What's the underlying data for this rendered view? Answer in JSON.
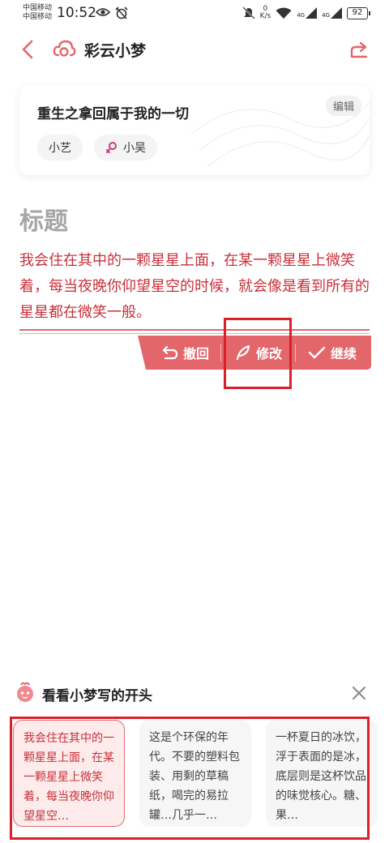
{
  "status": {
    "carrier_1": "中国移动",
    "carrier_2": "中国移动",
    "time": "10:52",
    "speed_value": "0",
    "speed_unit": "K/s",
    "net_1": "4G",
    "net_2": "4G",
    "battery": "92"
  },
  "header": {
    "title": "彩云小梦"
  },
  "story": {
    "title": "重生之拿回属于我的一切",
    "edit_label": "编辑",
    "characters": [
      "小艺",
      "小吴"
    ]
  },
  "content": {
    "section_title": "标题",
    "text": "我会住在其中的一颗星星上面，在某一颗星星上微笑着，每当夜晚你仰望星空的时候，就会像是看到所有的星星都在微笑一般。"
  },
  "actions": {
    "undo": "撤回",
    "modify": "修改",
    "continue": "继续"
  },
  "panel": {
    "title": "看看小梦写的开头",
    "suggestions": [
      "我会住在其中的一颗星星上面，在某一颗星星上微笑着，每当夜晚你仰望星空…",
      "这是个环保的年代。不要的塑料包装、用剩的草稿纸，喝完的易拉罐…几乎一…",
      "一杯夏日的冰饮，浮于表面的是冰，底层则是这杯饮品的味觉核心。糖、果…"
    ]
  },
  "colors": {
    "accent": "#e3666b",
    "text_red": "#c8303a",
    "highlight": "#d9202b"
  },
  "icons": [
    "back-icon",
    "cloud-logo-icon",
    "share-icon",
    "female-icon",
    "undo-icon",
    "feather-icon",
    "check-icon",
    "mascot-icon",
    "close-icon"
  ]
}
